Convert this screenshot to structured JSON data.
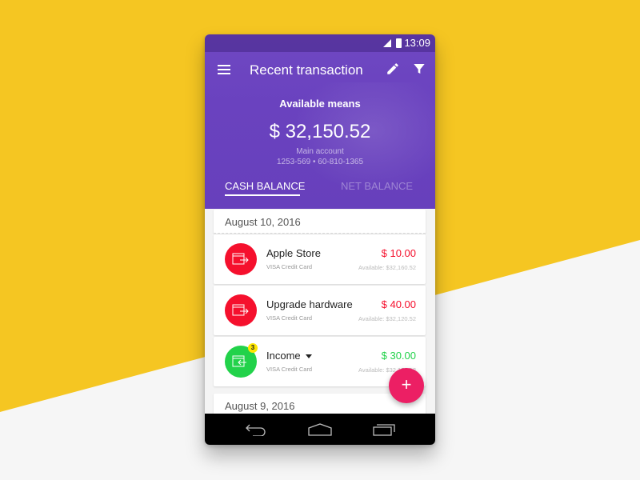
{
  "status_bar": {
    "time": "13:09",
    "signal_icon": "signal-icon",
    "battery_icon": "battery-icon"
  },
  "toolbar": {
    "title": "Recent transaction",
    "menu_icon": "hamburger-menu-icon",
    "edit_icon": "pencil-icon",
    "filter_icon": "filter-icon"
  },
  "summary": {
    "label": "Available means",
    "amount": "$ 32,150.52",
    "account_name": "Main account",
    "account_number": "1253-569 • 60-810-1365"
  },
  "tabs": [
    {
      "label": "CASH BALANCE",
      "active": true
    },
    {
      "label": "NET BALANCE",
      "active": false
    }
  ],
  "groups": [
    {
      "date": "August 10, 2016",
      "transactions": [
        {
          "name": "Apple Store",
          "card": "VISA Credit Card",
          "amount": "$ 10.00",
          "available": "Available: $32,160.52",
          "type": "expense",
          "color": "#f5102d",
          "icon": "wallet-out-icon"
        },
        {
          "name": "Upgrade hardware",
          "card": "VISA Credit Card",
          "amount": "$ 40.00",
          "available": "Available: $32,120.52",
          "type": "expense",
          "color": "#f5102d",
          "icon": "wallet-out-icon"
        },
        {
          "name": "Income",
          "card": "VISA Credit Card",
          "amount": "$ 30.00",
          "available": "Available: $32,150.52",
          "type": "income",
          "color": "#22d24a",
          "icon": "wallet-in-icon",
          "badge": "3",
          "has_dropdown": true
        }
      ]
    },
    {
      "date": "August 9, 2016",
      "transactions": []
    }
  ],
  "fab": {
    "label": "+",
    "icon": "plus-icon"
  },
  "nav_bar": {
    "back_icon": "back-icon",
    "home_icon": "home-icon",
    "recents_icon": "recents-icon"
  },
  "colors": {
    "header": "#6a42bf",
    "expense": "#f5102d",
    "income": "#22d24a",
    "fab": "#ec1f64",
    "background_accent": "#f5c622"
  }
}
